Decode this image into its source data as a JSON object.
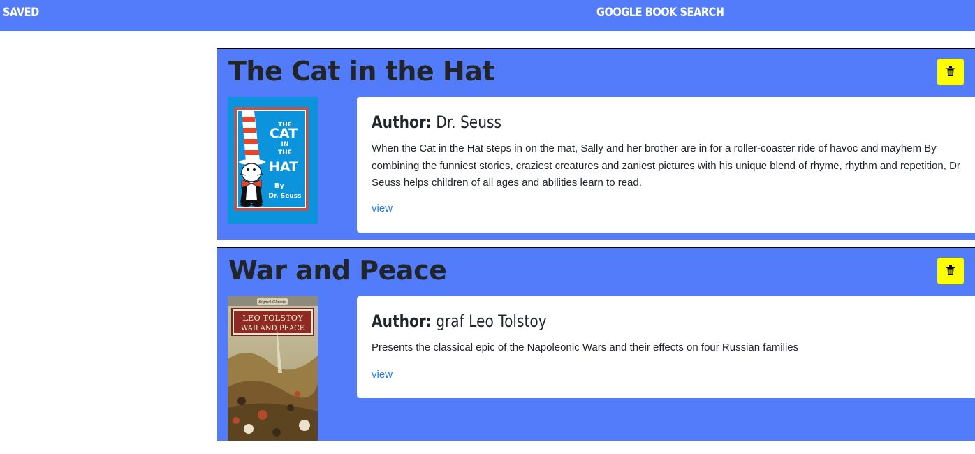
{
  "nav": {
    "saved_label": "SAVED",
    "search_label": "GOOGLE BOOK SEARCH"
  },
  "colors": {
    "accent": "#527cf9",
    "delete_button": "#ffff00",
    "link": "#1f7cf1"
  },
  "books": [
    {
      "title": "The Cat in the Hat",
      "author_label": "Author:",
      "author": "Dr. Seuss",
      "description": "When the Cat in the Hat steps in on the mat, Sally and her brother are in for a roller-coaster ride of havoc and mayhem By combining the funniest stories, craziest creatures and zaniest pictures with his unique blend of rhyme, rhythm and repetition, Dr Seuss helps children of all ages and abilities learn to read.",
      "view_label": "view",
      "cover": {
        "line1": "THE",
        "line2": "CAT",
        "line3": "IN",
        "line4": "THE",
        "line5": "HAT",
        "line6": "By",
        "line7": "Dr. Seuss"
      },
      "delete_icon": "trash-icon"
    },
    {
      "title": "War and Peace",
      "author_label": "Author:",
      "author": "graf Leo Tolstoy",
      "description": "Presents the classical epic of the Napoleonic Wars and their effects on four Russian families",
      "view_label": "view",
      "cover": {
        "publisher": "Signet Classic",
        "line1": "LEO TOLSTOY",
        "line2": "WAR AND PEACE"
      },
      "delete_icon": "trash-icon"
    }
  ]
}
